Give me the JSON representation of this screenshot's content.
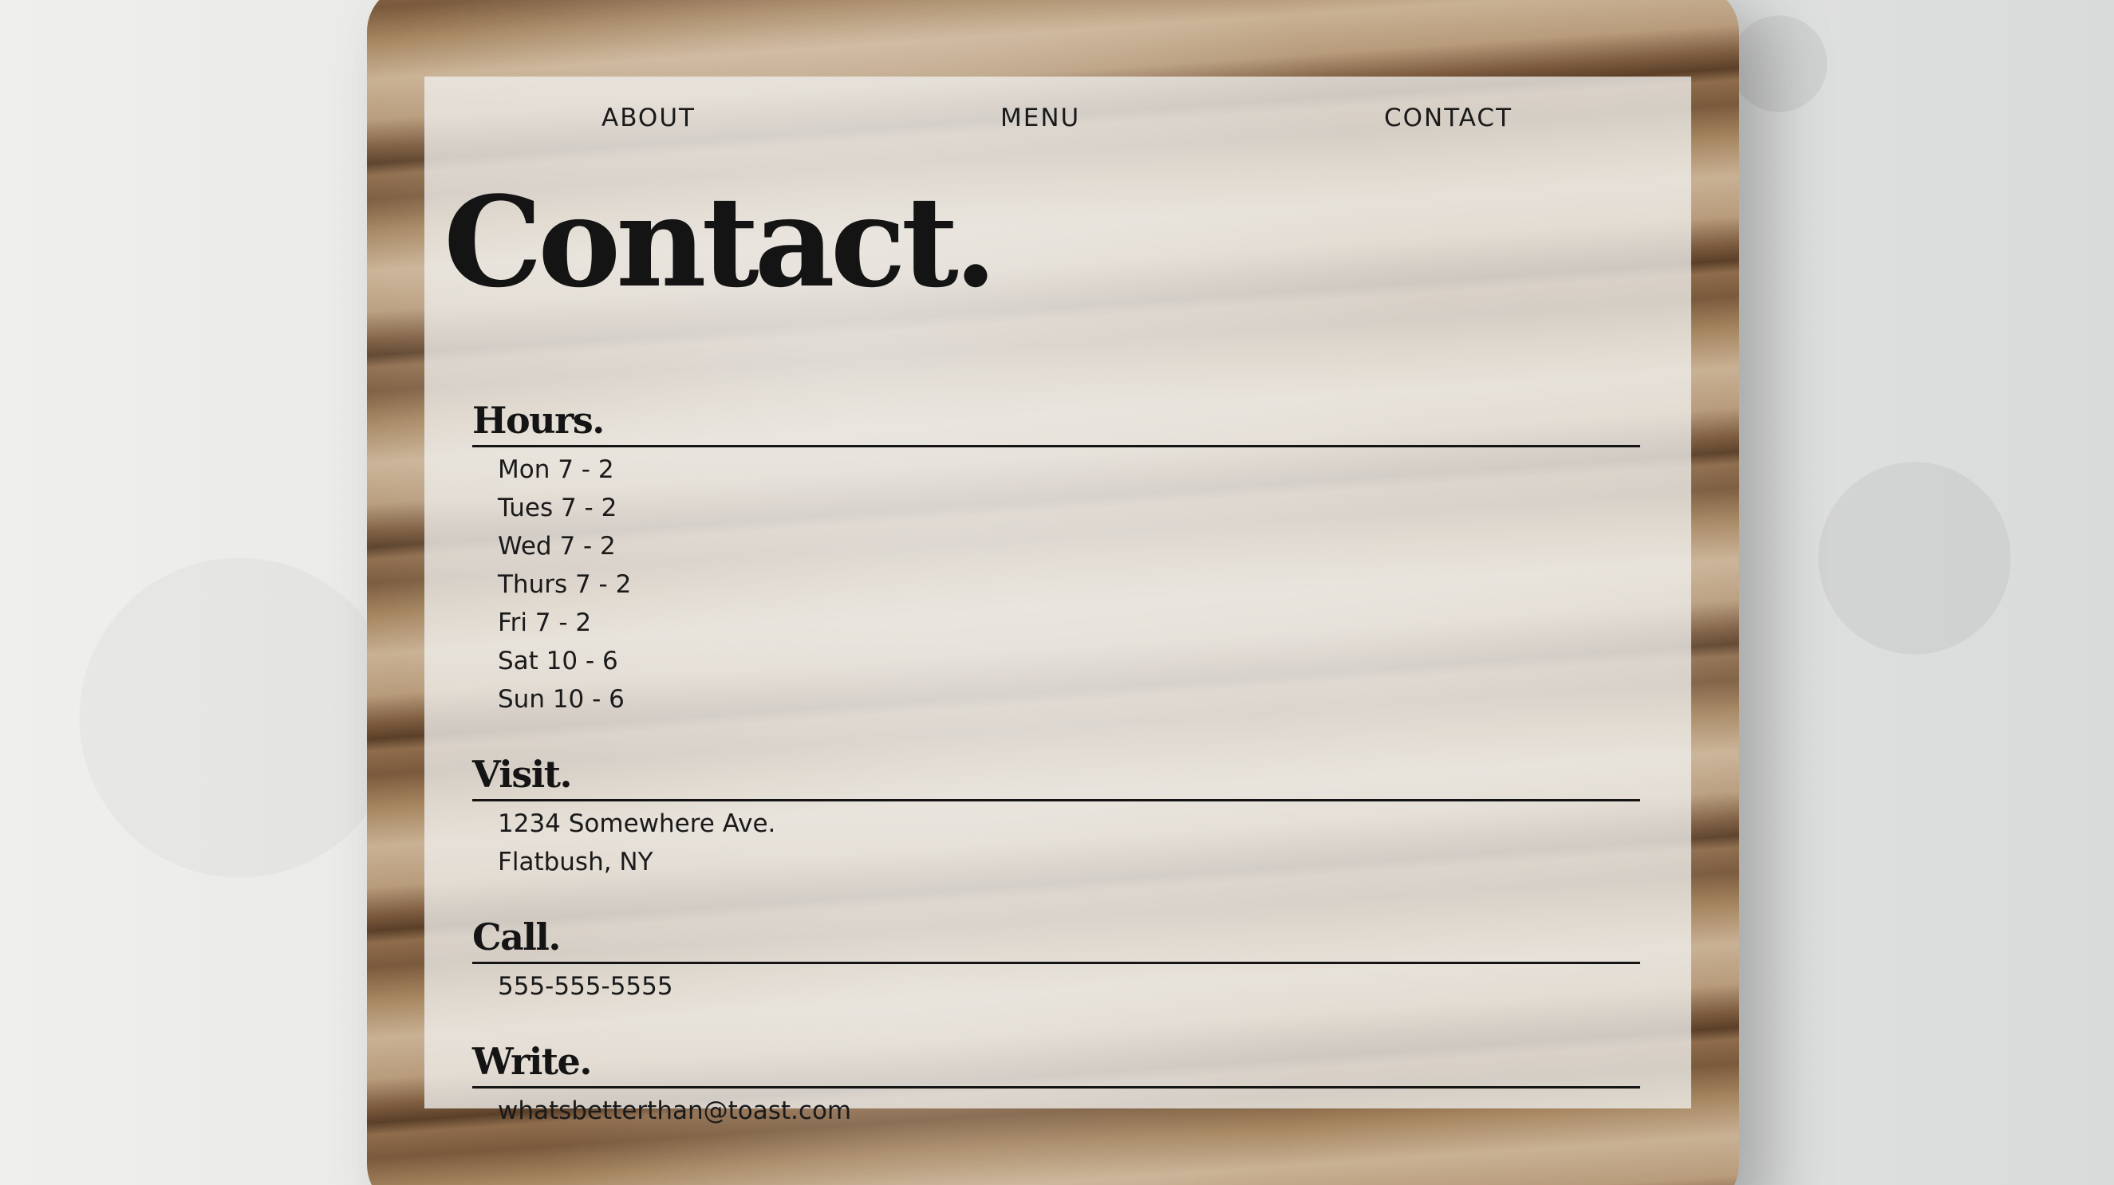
{
  "nav": {
    "about": "ABOUT",
    "menu": "MENU",
    "contact": "CONTACT"
  },
  "page": {
    "title": "Contact."
  },
  "hours": {
    "heading": "Hours.",
    "items": [
      "Mon 7 - 2",
      "Tues 7 - 2",
      "Wed 7 - 2",
      "Thurs 7 - 2",
      "Fri 7 - 2",
      "Sat 10 - 6",
      "Sun 10 - 6"
    ]
  },
  "visit": {
    "heading": "Visit.",
    "lines": [
      "1234 Somewhere Ave.",
      "Flatbush, NY"
    ]
  },
  "call": {
    "heading": "Call.",
    "phone": "555-555-5555"
  },
  "write": {
    "heading": "Write.",
    "email": "whatsbetterthan@toast.com"
  },
  "colors": {
    "text": "#141414",
    "panel": "#eeeeec"
  }
}
